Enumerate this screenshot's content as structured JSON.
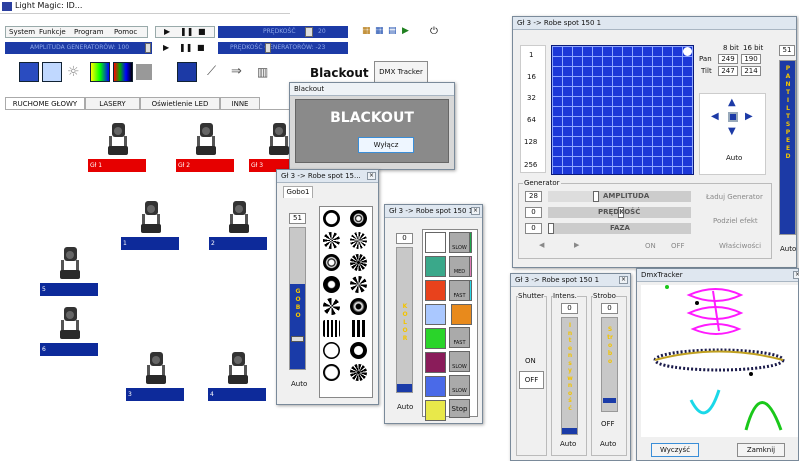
{
  "app": {
    "title": "Light Magic: ID...",
    "menu": [
      "System",
      "Funkcje",
      "Program",
      "Pomoc"
    ]
  },
  "toolbar": {
    "speed_label": "PRĘDKOŚĆ",
    "speed_value": "20",
    "amp_label": "AMPLITUDA GENERATORÓW: 100",
    "speed2_label": "PRĘDKOŚĆ GENERATORÓW: -23",
    "blackout": "Blackout",
    "dmx_tracker": "DMX Tracker"
  },
  "tabs": [
    "RUCHOME GŁOWY",
    "LASERY",
    "Oświetlenie LED",
    "INNE"
  ],
  "lights": [
    {
      "label": "Gł 1"
    },
    {
      "label": "Gł 2"
    },
    {
      "label": "Gł 3"
    },
    {
      "label": "1"
    },
    {
      "label": "2"
    },
    {
      "label": "5"
    },
    {
      "label": "6"
    },
    {
      "label": "3"
    },
    {
      "label": "4"
    }
  ],
  "blackout_win": {
    "title": "Blackout",
    "heading": "BLACKOUT",
    "button": "Wyłącz"
  },
  "gobo_win": {
    "title": "Gł 3 -> Robe spot 15...",
    "tab": "Gobo1",
    "value": "51",
    "bar_label": "GOBO",
    "mode": "Auto"
  },
  "color_win": {
    "title": "Gł 3 -> Robe spot 150 1",
    "value": "0",
    "bar_label": "KOLOR",
    "mode": "Auto",
    "stop": "Stop",
    "slow": "SLOW",
    "med": "MED",
    "fast": "FAST",
    "colors": [
      "#ffffff",
      "#1aa84a",
      "#3aa88a",
      "#e07ab8",
      "#e8421c",
      "#28d8e8",
      "#e88a1c",
      "#2ad42a",
      "#8a1c5a",
      "#4a6ae8",
      "#e8e84a"
    ]
  },
  "main_win": {
    "title": "Gł 3 -> Robe spot 150 1",
    "ticks": [
      "1",
      "16",
      "32",
      "64",
      "128",
      "256"
    ],
    "bit8": "8 bit",
    "bit16": "16 bit",
    "pan_label": "Pan",
    "pan8": "249",
    "pan16": "190",
    "tilt_label": "Tilt",
    "tilt8": "247",
    "tilt16": "214",
    "auto": "Auto",
    "side_value": "51",
    "side_label": "PAN TILT SPEED",
    "side_auto": "Auto"
  },
  "generator": {
    "title": "Generator",
    "amp_value": "28",
    "amp_label": "AMPLITUDA",
    "speed_value": "0",
    "speed_label": "PRĘDKOŚĆ",
    "phase_value": "0",
    "phase_label": "FAZA",
    "load": "Ładuj Generator",
    "split": "Podziel efekt",
    "on": "ON",
    "off": "OFF",
    "props": "Właściwości"
  },
  "shutter_win": {
    "title": "Gł 3 -> Robe spot 150 1",
    "shutter": "Shutter",
    "intens": "Intens.",
    "strobo": "Strobo",
    "intens_value": "0",
    "strobo_value": "0",
    "on": "ON",
    "off": "OFF",
    "intens_bar": "Intensywność",
    "strobo_bar": "Strobo",
    "strobo_off": "OFF",
    "auto": "Auto"
  },
  "dmx_win": {
    "title": "DmxTracker",
    "clear": "Wyczyść",
    "close": "Zamknij"
  }
}
